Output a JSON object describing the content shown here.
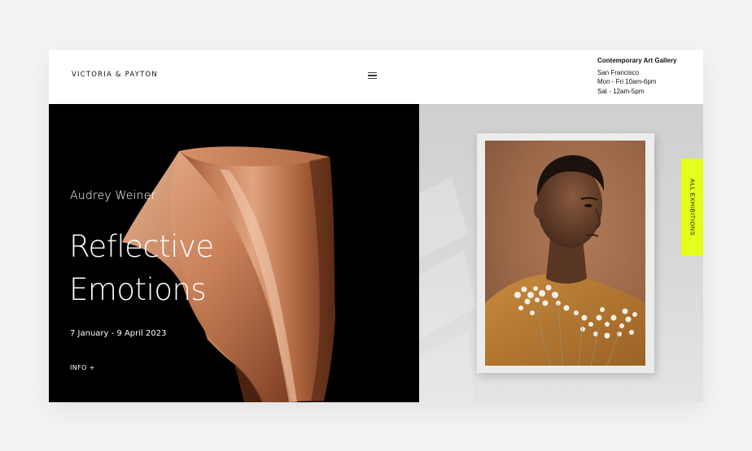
{
  "header": {
    "logo": "VICTORIA & PAYTON",
    "menu_icon": "hamburger-icon",
    "gallery_name": "Contemporary Art Gallery",
    "city": "San Francisco",
    "hours_weekday": "Mon - Fri 10am-6pm",
    "hours_weekend": "Sat - 12am-5pm"
  },
  "hero": {
    "artist": "Audrey Weiner",
    "title_line1": "Reflective",
    "title_line2": "Emotions",
    "dates": "7 January - 9 April 2023",
    "info_link": "INFO +"
  },
  "side_tab": {
    "label": "ALL EXHIBITIONS"
  },
  "colors": {
    "accent": "#e4ff1a",
    "hero_bg": "#000000",
    "cloth": "#c07a52",
    "wall": "#d9d9d9"
  }
}
